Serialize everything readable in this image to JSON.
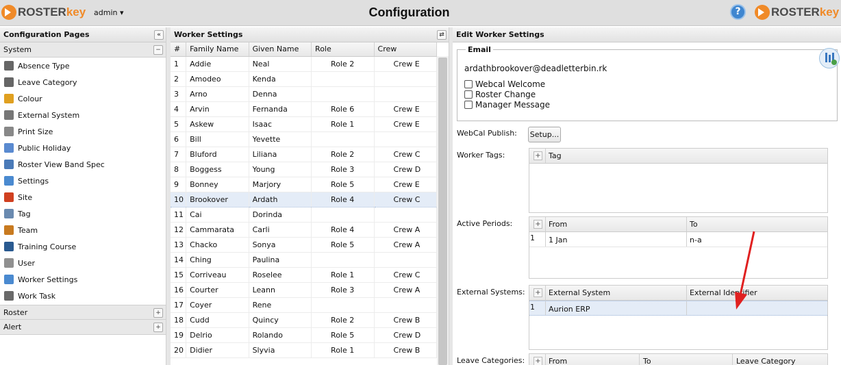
{
  "header": {
    "logo_left_a": "ROSTER",
    "logo_left_b": "key",
    "user": "admin ▾",
    "title": "Configuration",
    "help": "?",
    "logo_right_a": "ROSTER",
    "logo_right_b": "key"
  },
  "left_panel": {
    "title": "Configuration Pages",
    "collapse": "«",
    "system_label": "System",
    "system_toggle": "−",
    "items": [
      {
        "label": "Absence Type",
        "icon": "person-icon",
        "color": "#666666"
      },
      {
        "label": "Leave Category",
        "icon": "person-icon",
        "color": "#666666"
      },
      {
        "label": "Colour",
        "icon": "palette-icon",
        "color": "#e0a020"
      },
      {
        "label": "External System",
        "icon": "arrows-icon",
        "color": "#777777"
      },
      {
        "label": "Print Size",
        "icon": "page-icon",
        "color": "#888888"
      },
      {
        "label": "Public Holiday",
        "icon": "calendar-icon",
        "color": "#5a8ad0"
      },
      {
        "label": "Roster View Band Spec",
        "icon": "grid-icon",
        "color": "#4a7ab8"
      },
      {
        "label": "Settings",
        "icon": "settings-icon",
        "color": "#4a8ad0"
      },
      {
        "label": "Site",
        "icon": "factory-icon",
        "color": "#d04020"
      },
      {
        "label": "Tag",
        "icon": "tag-icon",
        "color": "#6a8ab0"
      },
      {
        "label": "Team",
        "icon": "team-icon",
        "color": "#c87a20"
      },
      {
        "label": "Training Course",
        "icon": "trainer-icon",
        "color": "#2a5a90"
      },
      {
        "label": "User",
        "icon": "keyboard-icon",
        "color": "#909090"
      },
      {
        "label": "Worker Settings",
        "icon": "settings-icon",
        "color": "#4a8ad0"
      },
      {
        "label": "Work Task",
        "icon": "task-icon",
        "color": "#6a6a6a"
      }
    ],
    "roster_label": "Roster",
    "alert_label": "Alert",
    "expand": "+"
  },
  "worker_panel": {
    "title": "Worker Settings",
    "columns": [
      "#",
      "Family Name",
      "Given Name",
      "Role",
      "Crew"
    ],
    "rows": [
      [
        "1",
        "Addie",
        "Neal",
        "Role 2",
        "Crew E"
      ],
      [
        "2",
        "Amodeo",
        "Kenda",
        "",
        ""
      ],
      [
        "3",
        "Arno",
        "Denna",
        "",
        ""
      ],
      [
        "4",
        "Arvin",
        "Fernanda",
        "Role 6",
        "Crew E"
      ],
      [
        "5",
        "Askew",
        "Isaac",
        "Role 1",
        "Crew E"
      ],
      [
        "6",
        "Bill",
        "Yevette",
        "",
        ""
      ],
      [
        "7",
        "Bluford",
        "Liliana",
        "Role 2",
        "Crew C"
      ],
      [
        "8",
        "Boggess",
        "Young",
        "Role 3",
        "Crew D"
      ],
      [
        "9",
        "Bonney",
        "Marjory",
        "Role 5",
        "Crew E"
      ],
      [
        "10",
        "Brookover",
        "Ardath",
        "Role 4",
        "Crew C"
      ],
      [
        "11",
        "Cai",
        "Dorinda",
        "",
        ""
      ],
      [
        "12",
        "Cammarata",
        "Carli",
        "Role 4",
        "Crew A"
      ],
      [
        "13",
        "Chacko",
        "Sonya",
        "Role 5",
        "Crew A"
      ],
      [
        "14",
        "Ching",
        "Paulina",
        "",
        ""
      ],
      [
        "15",
        "Corriveau",
        "Roselee",
        "Role 1",
        "Crew C"
      ],
      [
        "16",
        "Courter",
        "Leann",
        "Role 3",
        "Crew A"
      ],
      [
        "17",
        "Coyer",
        "Rene",
        "",
        ""
      ],
      [
        "18",
        "Cudd",
        "Quincy",
        "Role 2",
        "Crew B"
      ],
      [
        "19",
        "Delrio",
        "Rolando",
        "Role 5",
        "Crew D"
      ],
      [
        "20",
        "Didier",
        "Slyvia",
        "Role 1",
        "Crew B"
      ]
    ],
    "selected_row": 9
  },
  "edit_panel": {
    "title": "Edit Worker Settings",
    "email_legend": "Email",
    "email": "ardathbrookover@deadletterbin.rk",
    "checkboxes": [
      "Webcal Welcome",
      "Roster Change",
      "Manager Message"
    ],
    "webcal_label": "WebCal Publish:",
    "setup_button": "Setup...",
    "tags_label": "Worker Tags:",
    "tags_col": "Tag",
    "active_label": "Active Periods:",
    "active_cols": [
      "From",
      "To"
    ],
    "active_row": {
      "n": "1",
      "from": "1 Jan",
      "to": "n-a"
    },
    "ext_label": "External Systems:",
    "ext_cols": [
      "External System",
      "External Identifier"
    ],
    "ext_row": {
      "n": "1",
      "system": "Aurion ERP"
    },
    "leave_label": "Leave Categories:",
    "leave_cols": [
      "From",
      "To",
      "Leave Category"
    ],
    "add": "+"
  },
  "annotation": {
    "arrow_color": "#e02020"
  }
}
